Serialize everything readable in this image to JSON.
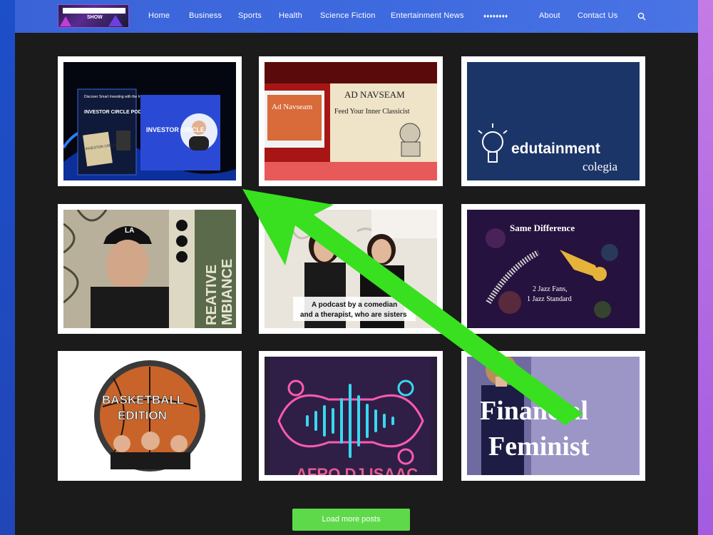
{
  "nav": {
    "logo_text": "SHOW",
    "items": [
      {
        "label": "Home"
      },
      {
        "label": "Business"
      },
      {
        "label": "Sports"
      },
      {
        "label": "Health"
      },
      {
        "label": "Science Fiction"
      },
      {
        "label": "Entertainment News"
      },
      {
        "label": "♦♦♦♦♦♦♦♦"
      },
      {
        "label": "About"
      },
      {
        "label": "Contact Us"
      }
    ],
    "search_icon": "search-icon"
  },
  "posts": [
    {
      "title": "Investor Circle Podcast",
      "texts": [
        "Discover Smart Investing with the Investor Circle Podcast!",
        "INVESTOR CIRCLE PODCAST",
        "INVESTOR CIRCLE",
        "INVESTOR CIRCLE"
      ]
    },
    {
      "title": "Ad Navseam",
      "texts": [
        "AD NAVSEAM",
        "Feed Your Inner Classicist",
        "Ad Navseam"
      ]
    },
    {
      "title": "edutainment colegia",
      "texts": [
        "edutainment",
        "colegia"
      ]
    },
    {
      "title": "Creative Ambiance",
      "texts": [
        "REATIVE",
        "MBIANCE",
        "LA"
      ]
    },
    {
      "title": "Sisters podcast",
      "texts": [
        "A podcast by a comedian",
        "and a therapist, who are sisters"
      ]
    },
    {
      "title": "Same Difference",
      "texts": [
        "Same Difference",
        "2 Jazz Fans,",
        "1 Jazz Standard"
      ]
    },
    {
      "title": "Basketball Edition",
      "texts": [
        "BASKETBALL",
        "EDITION"
      ]
    },
    {
      "title": "Afro DJ Isaac",
      "texts": [
        "AFRO DJ ISAAC"
      ]
    },
    {
      "title": "Financial Feminist",
      "texts": [
        "Financial",
        "Feminist"
      ]
    }
  ],
  "load_more": {
    "label": "Load more posts"
  },
  "colors": {
    "accent_green": "#5ed94a",
    "nav_blue": "#3f6be0"
  }
}
